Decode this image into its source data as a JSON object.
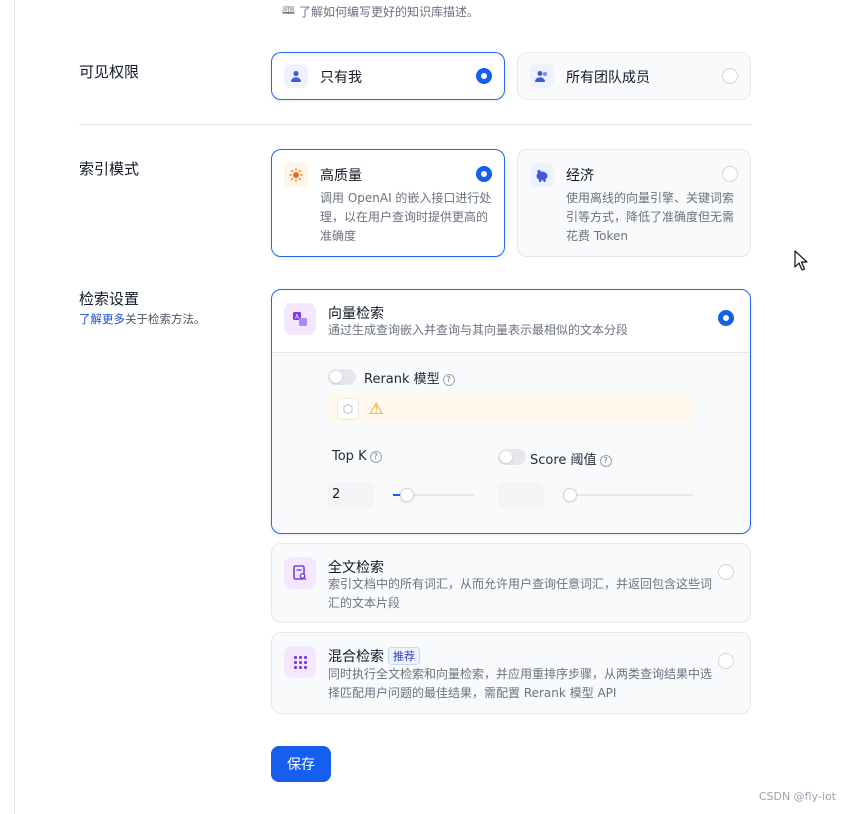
{
  "tip": {
    "text": "了解如何编写更好的知识库描述。",
    "icon": "book-icon"
  },
  "visibility": {
    "label": "可见权限",
    "options": [
      {
        "label": "只有我",
        "icon": "user-icon",
        "selected": true
      },
      {
        "label": "所有团队成员",
        "icon": "team-icon",
        "selected": false
      }
    ]
  },
  "index_mode": {
    "label": "索引模式",
    "options": [
      {
        "label": "高质量",
        "icon": "sun-icon",
        "desc_lines": [
          "调用 OpenAI 的嵌入接口进行处",
          "理，以在用户查询时提供更高的",
          "准确度"
        ],
        "selected": true
      },
      {
        "label": "经济",
        "icon": "piggy-bank-icon",
        "desc_lines": [
          "使用离线的向量引擎、关键词索",
          "引等方式，降低了准确度但无需",
          "花费 Token"
        ],
        "selected": false
      }
    ]
  },
  "retrieval": {
    "label": "检索设置",
    "sub_link": "了解更多",
    "sub_text": "关于检索方法。",
    "vector": {
      "title": "向量检索",
      "desc": "通过生成查询嵌入并查询与其向量表示最相似的文本分段",
      "selected": true,
      "rerank_label": "Rerank 模型",
      "rerank_enabled": false,
      "topk_label": "Top K",
      "topk_value": "2",
      "topk_fraction": 0.1,
      "score_label": "Score 阈值",
      "score_enabled": false,
      "score_value": "",
      "score_fraction": 0.0
    },
    "fulltext": {
      "title": "全文检索",
      "desc_lines": [
        "索引文档中的所有词汇，从而允许用户查询任意词汇，并返回包含这些词",
        "汇的文本片段"
      ],
      "selected": false
    },
    "hybrid": {
      "title": "混合检索",
      "badge": "推荐",
      "desc_lines": [
        "同时执行全文检索和向量检索，并应用重排序步骤，从两类查询结果中选",
        "择匹配用户问题的最佳结果，需配置 Rerank 模型 API"
      ],
      "selected": false
    }
  },
  "save_label": "保存",
  "watermark": "CSDN @fly-iot",
  "colors": {
    "primary": "#155eef",
    "warning": "#f79009"
  }
}
